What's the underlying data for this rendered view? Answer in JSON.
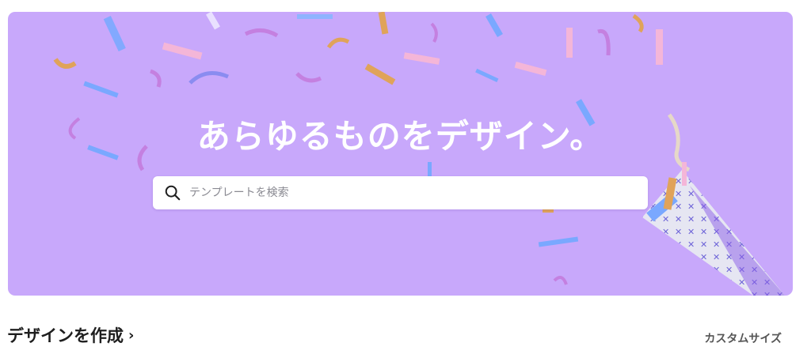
{
  "hero": {
    "title": "あらゆるものをデザイン。",
    "background_color": "#c8a8fb"
  },
  "search": {
    "placeholder": "テンプレートを検索",
    "icon": "search-icon"
  },
  "design_section": {
    "title": "デザインを作成",
    "chevron": "›",
    "custom_size_label": "カスタムサイズ"
  }
}
